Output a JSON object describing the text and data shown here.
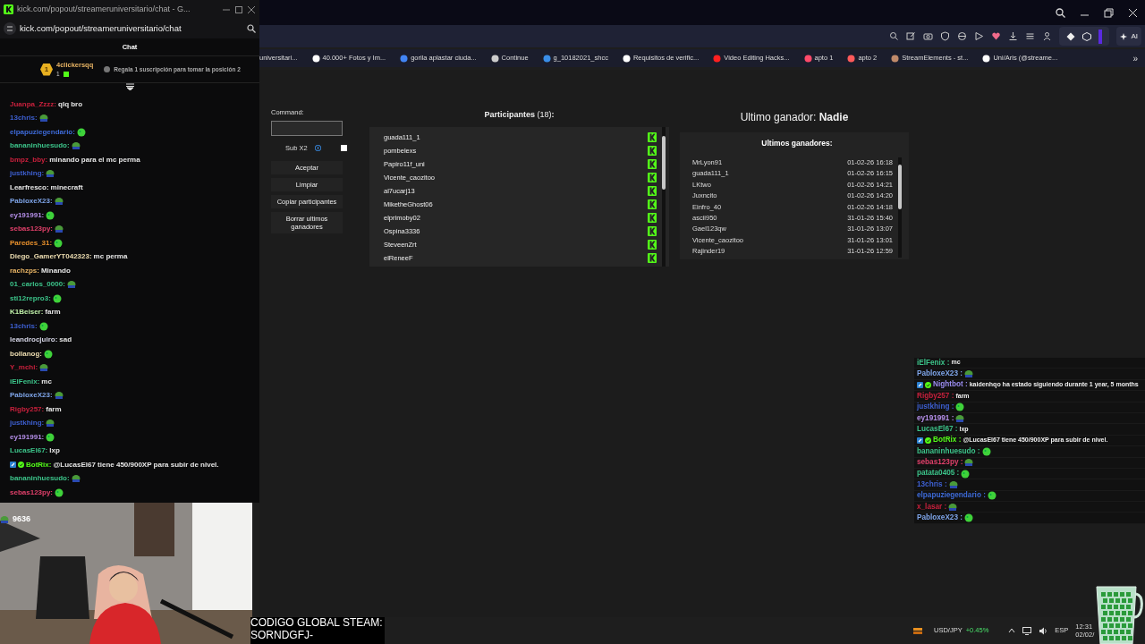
{
  "popup": {
    "title_bar": "kick.com/popout/streameruniversitario/chat - G...",
    "url": "kick.com/popout/streameruniversitario/chat",
    "header": "Chat",
    "leaderboard": {
      "rank": "1",
      "user": "4clickersqq",
      "count": "1",
      "hint": "Regala 1 suscripción para tomar la posición 2"
    },
    "messages": [
      {
        "user": "Juanpa_Zzzz:",
        "color": "#c8203c",
        "kind": "text",
        "text": "qlq bro"
      },
      {
        "user": "13chris:",
        "color": "#3d5fd0",
        "kind": "emote"
      },
      {
        "user": "elpapuziegendario:",
        "color": "#3d6ad8",
        "kind": "emote"
      },
      {
        "user": "bananinhuesudo:",
        "color": "#3cc48a",
        "kind": "emote"
      },
      {
        "user": "bmpz_bby:",
        "color": "#c8203c",
        "kind": "text",
        "text": "minando para el mc perma"
      },
      {
        "user": "justkhing:",
        "color": "#3d5fd0",
        "kind": "emote"
      },
      {
        "user": "Learfresco:",
        "color": "#e8e8e8",
        "kind": "text",
        "text": "minecraft"
      },
      {
        "user": "PabloxeX23:",
        "color": "#7ea4e8",
        "kind": "emote"
      },
      {
        "user": "ey191991:",
        "color": "#b48ee8",
        "kind": "emote"
      },
      {
        "user": "sebas123py:",
        "color": "#e0406a",
        "kind": "emote"
      },
      {
        "user": "Paredes_31:",
        "color": "#e8902c",
        "kind": "emote"
      },
      {
        "user": "Diego_GamerYT042323:",
        "color": "#ecdcb0",
        "kind": "text",
        "text": "mc perma"
      },
      {
        "user": "rachzps:",
        "color": "#e8b464",
        "kind": "text",
        "text": "Minando"
      },
      {
        "user": "01_carlos_0000:",
        "color": "#3cc48a",
        "kind": "emote"
      },
      {
        "user": "sti12repro3:",
        "color": "#3cc48a",
        "kind": "emote"
      },
      {
        "user": "K1Beiser:",
        "color": "#bff0a8",
        "kind": "text",
        "text": "farm"
      },
      {
        "user": "13chris:",
        "color": "#3d5fd0",
        "kind": "emote"
      },
      {
        "user": "leandrocjuiro:",
        "color": "#d4d4e4",
        "kind": "text",
        "text": "sad"
      },
      {
        "user": "bollanog:",
        "color": "#ecdcb0",
        "kind": "emote"
      },
      {
        "user": "Y_mchi:",
        "color": "#c8203c",
        "kind": "emote"
      },
      {
        "user": "iElFenix:",
        "color": "#3cc48a",
        "kind": "text",
        "text": "mc"
      },
      {
        "user": "PabloxeX23:",
        "color": "#7ea4e8",
        "kind": "emote"
      },
      {
        "user": "Rigby257:",
        "color": "#c8203c",
        "kind": "text",
        "text": "farm"
      },
      {
        "user": "justkhing:",
        "color": "#3d5fd0",
        "kind": "emote"
      },
      {
        "user": "ey191991:",
        "color": "#b48ee8",
        "kind": "emote"
      },
      {
        "user": "LucasEl67:",
        "color": "#3cc48a",
        "kind": "text",
        "text": "lxp"
      },
      {
        "user": "BotRix:",
        "color": "#53fc18",
        "kind": "bot",
        "text": "@LucasEl67 tiene 450/900XP para subir de nivel."
      },
      {
        "user": "bananinhuesudo:",
        "color": "#3cc48a",
        "kind": "emote"
      },
      {
        "user": "sebas123py:",
        "color": "#e0406a",
        "kind": "emote"
      }
    ]
  },
  "browser": {
    "bookmarks": [
      "universitari...",
      "40.000+ Fotos y Im...",
      "gorila aplastar ciuda...",
      "Continue",
      "g_10182021_shcc",
      "Requisitos de verific...",
      "Video Editing Hacks...",
      "apto 1",
      "apto 2",
      "StreamElements - st...",
      "Uni/Aris (@streame..."
    ],
    "more": "»",
    "ai_button": "AI"
  },
  "giveaway": {
    "command_label": "Command:",
    "sub_label": "Sub X2",
    "sub_checked": false,
    "buttons": [
      "Aceptar",
      "Limpiar",
      "Copiar participantes",
      "Borrar ultimos ganadores"
    ],
    "participants_title": "**Participantes** (18)**:**",
    "participants": [
      "guada111_1",
      "pombelexs",
      "Papiro11f_uni",
      "Vicente_caozitoo",
      "al7ucarj13",
      "MiketheGhost06",
      "elprimoby02",
      "Ospina3336",
      "SteveenZrt",
      "elReneeF"
    ],
    "last_winner": "Ultimo ganador: **Nadie**",
    "winners_title": "Ultimos ganadores:",
    "winners": [
      {
        "name": "MrLyon91",
        "date": "01-02-26 16:18"
      },
      {
        "name": "guada111_1",
        "date": "01-02-26 16:15"
      },
      {
        "name": "LKtwo",
        "date": "01-02-26 14:21"
      },
      {
        "name": "Juxncito",
        "date": "01-02-26 14:20"
      },
      {
        "name": "Einfro_40",
        "date": "01-02-26 14:18"
      },
      {
        "name": "ascii950",
        "date": "31-01-26 15:40"
      },
      {
        "name": "Gael123qw",
        "date": "31-01-26 13:07"
      },
      {
        "name": "Vicente_caozitoo",
        "date": "31-01-26 13:01"
      },
      {
        "name": "Rajinder19",
        "date": "31-01-26 12:59"
      }
    ]
  },
  "overlay_chat": {
    "messages": [
      {
        "user": "iElFenix :",
        "color": "#3cc48a",
        "kind": "text",
        "text": "mc"
      },
      {
        "user": "PabloxeX23 :",
        "color": "#7ea4e8",
        "kind": "emote"
      },
      {
        "user": "Nightbot :",
        "color": "#9a8cf0",
        "kind": "bot",
        "text": "kaidenhqo ha estado siguiendo durante 1 year, 5 months"
      },
      {
        "user": "Rigby257 :",
        "color": "#c8203c",
        "kind": "text",
        "text": "farm"
      },
      {
        "user": "justkhing :",
        "color": "#3d5fd0",
        "kind": "emote"
      },
      {
        "user": "ey191991 :",
        "color": "#b48ee8",
        "kind": "emote"
      },
      {
        "user": "LucasEl67 :",
        "color": "#3cc48a",
        "kind": "text",
        "text": "lxp"
      },
      {
        "user": "BotRix :",
        "color": "#53fc18",
        "kind": "bot",
        "text": "@LucasEl67 tiene 450/900XP para subir de nivel."
      },
      {
        "user": "bananinhuesudo :",
        "color": "#3cc48a",
        "kind": "emote"
      },
      {
        "user": "sebas123py :",
        "color": "#e0406a",
        "kind": "emote"
      },
      {
        "user": "patata0405 :",
        "color": "#3cc48a",
        "kind": "emote"
      },
      {
        "user": "13chris :",
        "color": "#3d5fd0",
        "kind": "emote"
      },
      {
        "user": "elpapuziegendario :",
        "color": "#3d6ad8",
        "kind": "emote"
      },
      {
        "user": "x_lasar :",
        "color": "#c8203c",
        "kind": "emote"
      },
      {
        "user": "PabloxeX23 :",
        "color": "#7ea4e8",
        "kind": "emote"
      }
    ]
  },
  "webcam": {
    "kind": "picture",
    "caption": "9636"
  },
  "code_banner": {
    "lines": [
      "CODIGO GLOBAL STEAM:",
      "SORNDGFJ-"
    ]
  },
  "taskbar": {
    "ticker": "USD/JPY",
    "change": "+0.45%",
    "language": "ESP",
    "time": "12:31",
    "date": "02/02/"
  }
}
